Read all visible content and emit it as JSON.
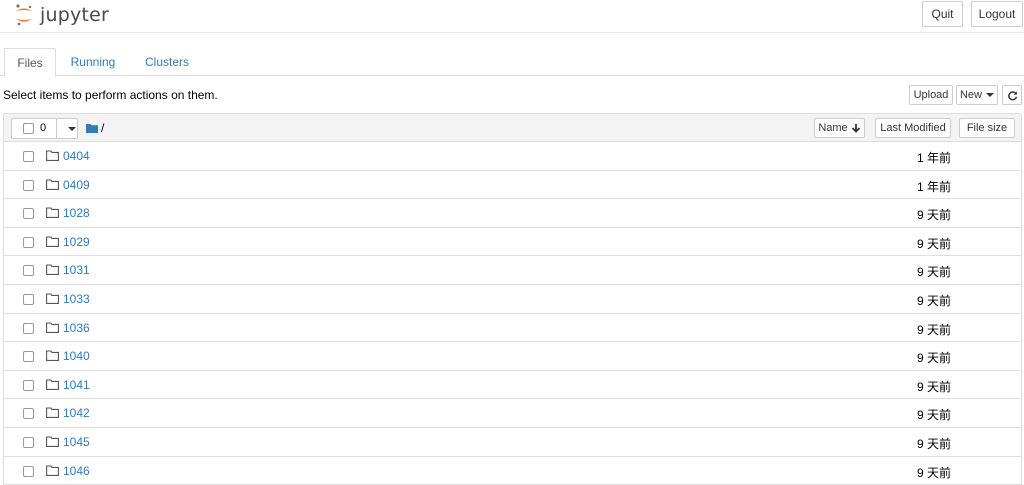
{
  "header": {
    "logo_text": "jupyter",
    "quit_label": "Quit",
    "logout_label": "Logout"
  },
  "tabs": [
    {
      "label": "Files",
      "active": true
    },
    {
      "label": "Running",
      "active": false
    },
    {
      "label": "Clusters",
      "active": false
    }
  ],
  "toolbar": {
    "hint": "Select items to perform actions on them.",
    "upload_label": "Upload",
    "new_label": "New",
    "refresh_icon": "refresh-icon"
  },
  "list_header": {
    "selected_count": "0",
    "path": "/",
    "name_label": "Name",
    "last_modified_label": "Last Modified",
    "file_size_label": "File size"
  },
  "files": [
    {
      "name": "0404",
      "modified": "1 年前"
    },
    {
      "name": "0409",
      "modified": "1 年前"
    },
    {
      "name": "1028",
      "modified": "9 天前"
    },
    {
      "name": "1029",
      "modified": "9 天前"
    },
    {
      "name": "1031",
      "modified": "9 天前"
    },
    {
      "name": "1033",
      "modified": "9 天前"
    },
    {
      "name": "1036",
      "modified": "9 天前"
    },
    {
      "name": "1040",
      "modified": "9 天前"
    },
    {
      "name": "1041",
      "modified": "9 天前"
    },
    {
      "name": "1042",
      "modified": "9 天前"
    },
    {
      "name": "1045",
      "modified": "9 天前"
    },
    {
      "name": "1046",
      "modified": "9 天前"
    }
  ],
  "colors": {
    "link": "#337ab7",
    "logo_orange": "#f37726",
    "folder_blue": "#337ab7"
  }
}
